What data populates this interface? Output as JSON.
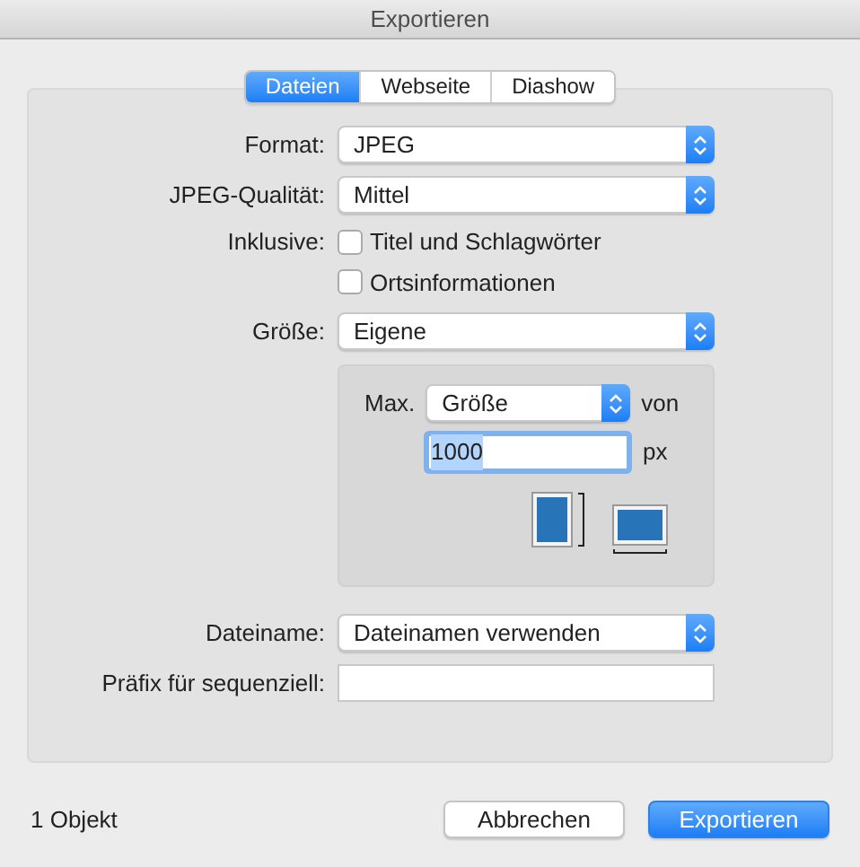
{
  "window": {
    "title": "Exportieren"
  },
  "tabs": [
    {
      "label": "Dateien",
      "selected": true
    },
    {
      "label": "Webseite",
      "selected": false
    },
    {
      "label": "Diashow",
      "selected": false
    }
  ],
  "format": {
    "label": "Format:",
    "value": "JPEG"
  },
  "quality": {
    "label": "JPEG-Qualität:",
    "value": "Mittel"
  },
  "include": {
    "label": "Inklusive:",
    "options": [
      {
        "label": "Titel und Schlagwörter",
        "checked": false
      },
      {
        "label": "Ortsinformationen",
        "checked": false
      }
    ]
  },
  "size": {
    "label": "Größe:",
    "value": "Eigene"
  },
  "custom_size": {
    "prefix": "Max.",
    "dimension": "Größe",
    "suffix": "von",
    "value": "1000",
    "unit": "px"
  },
  "filename": {
    "label": "Dateiname:",
    "value": "Dateinamen verwenden"
  },
  "prefix": {
    "label": "Präfix für sequenziell:"
  },
  "status": "1 Objekt",
  "buttons": [
    {
      "label": "Abbrechen",
      "kind": "default"
    },
    {
      "label": "Exportieren",
      "kind": "primary"
    }
  ]
}
